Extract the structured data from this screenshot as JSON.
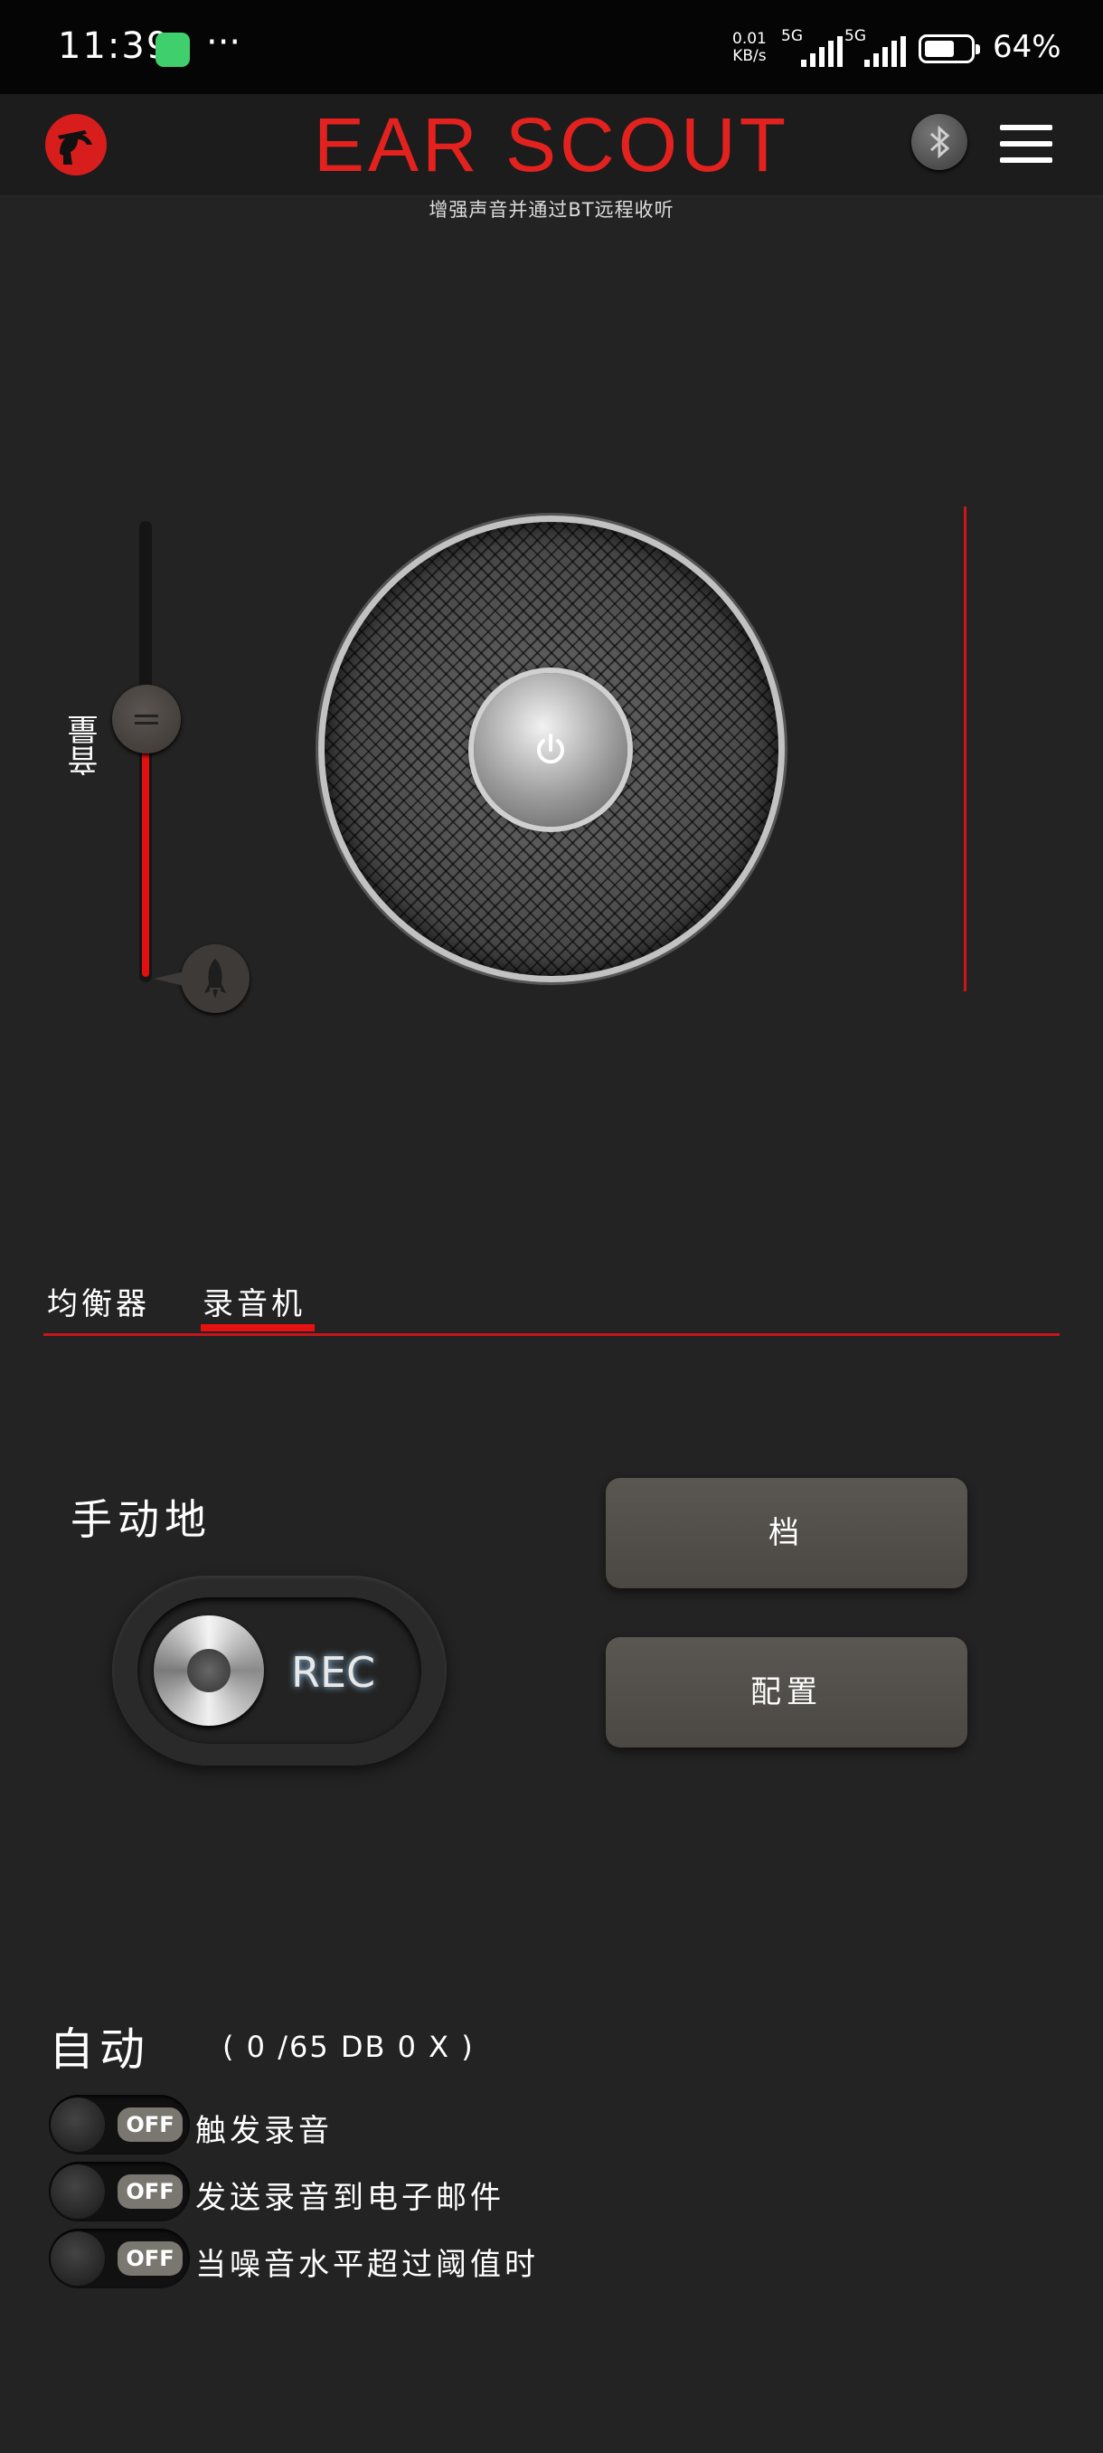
{
  "status_bar": {
    "time": "11:39",
    "more": "···",
    "net_speed_value": "0.01",
    "net_speed_unit": "KB/s",
    "network_1": "5G",
    "network_2": "5G",
    "battery_percent": "64%",
    "battery_level": 0.64
  },
  "header": {
    "title": "EAR SCOUT",
    "subtitle": "增强声音并通过BT远程收听",
    "icons": [
      "logo-icon",
      "bluetooth-icon",
      "menu-icon"
    ]
  },
  "volume": {
    "label": "音量",
    "level": 0.57
  },
  "tabs": [
    {
      "label": "均衡器",
      "active": false
    },
    {
      "label": "录音机",
      "active": true
    }
  ],
  "manual": {
    "label": "手动地",
    "rec_label": "REC",
    "file_button": "档",
    "config_button": "配置"
  },
  "auto": {
    "label": "自动",
    "status": "( 0 /65 DB   0 X )",
    "switches": [
      {
        "state": "OFF",
        "label": "触发录音"
      },
      {
        "state": "OFF",
        "label": "发送录音到电子邮件"
      },
      {
        "state": "OFF",
        "label": "当噪音水平超过阈值时"
      }
    ]
  },
  "colors": {
    "accent_red": "#e3221f",
    "background": "#232323",
    "button": "#524e4a"
  }
}
